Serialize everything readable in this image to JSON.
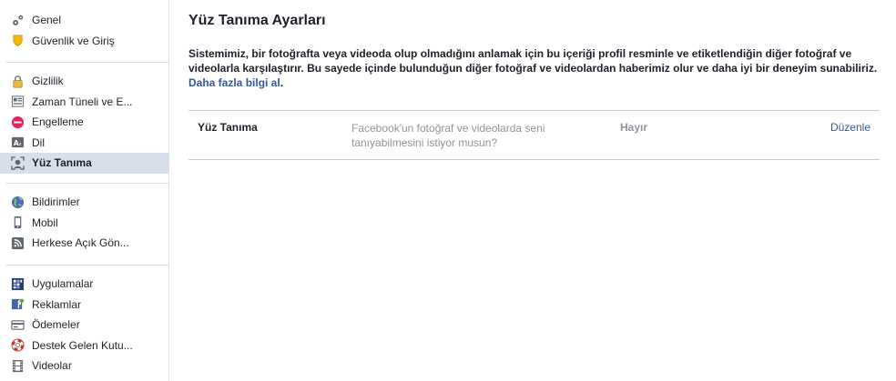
{
  "sidebar": {
    "groups": [
      [
        {
          "label": "Genel",
          "icon": "gear-icon"
        },
        {
          "label": "Güvenlik ve Giriş",
          "icon": "shield-icon"
        }
      ],
      [
        {
          "label": "Gizlilik",
          "icon": "lock-icon"
        },
        {
          "label": "Zaman Tüneli ve E...",
          "icon": "timeline-icon"
        },
        {
          "label": "Engelleme",
          "icon": "block-icon"
        },
        {
          "label": "Dil",
          "icon": "language-icon"
        },
        {
          "label": "Yüz Tanıma",
          "icon": "face-recognition-icon",
          "active": true
        }
      ],
      [
        {
          "label": "Bildirimler",
          "icon": "globe-icon"
        },
        {
          "label": "Mobil",
          "icon": "mobile-icon"
        },
        {
          "label": "Herkese Açık Gön...",
          "icon": "rss-icon"
        }
      ],
      [
        {
          "label": "Uygulamalar",
          "icon": "apps-icon"
        },
        {
          "label": "Reklamlar",
          "icon": "ads-icon"
        },
        {
          "label": "Ödemeler",
          "icon": "payments-icon"
        },
        {
          "label": "Destek Gelen Kutu...",
          "icon": "lifebuoy-icon"
        },
        {
          "label": "Videolar",
          "icon": "film-icon"
        }
      ]
    ]
  },
  "main": {
    "title": "Yüz Tanıma Ayarları",
    "intro": "Sistemimiz, bir fotoğrafta veya videoda olup olmadığını anlamak için bu içeriği profil resminle ve etiketlendiğin diğer fotoğraf ve videolarla karşılaştırır. Bu sayede içinde bulunduğun diğer fotoğraf ve videolardan haberimiz olur ve daha iyi bir deneyim sunabiliriz.",
    "learn_more": "Daha fazla bilgi al",
    "learn_more_suffix": ".",
    "setting": {
      "title": "Yüz Tanıma",
      "description": "Facebook'un fotoğraf ve videolarda seni tanıyabilmesini istiyor musun?",
      "value": "Hayır",
      "edit_label": "Düzenle"
    }
  },
  "colors": {
    "link": "#365899",
    "muted": "#90949c",
    "active_bg": "#d8dfea",
    "divider": "#dddfe2"
  }
}
